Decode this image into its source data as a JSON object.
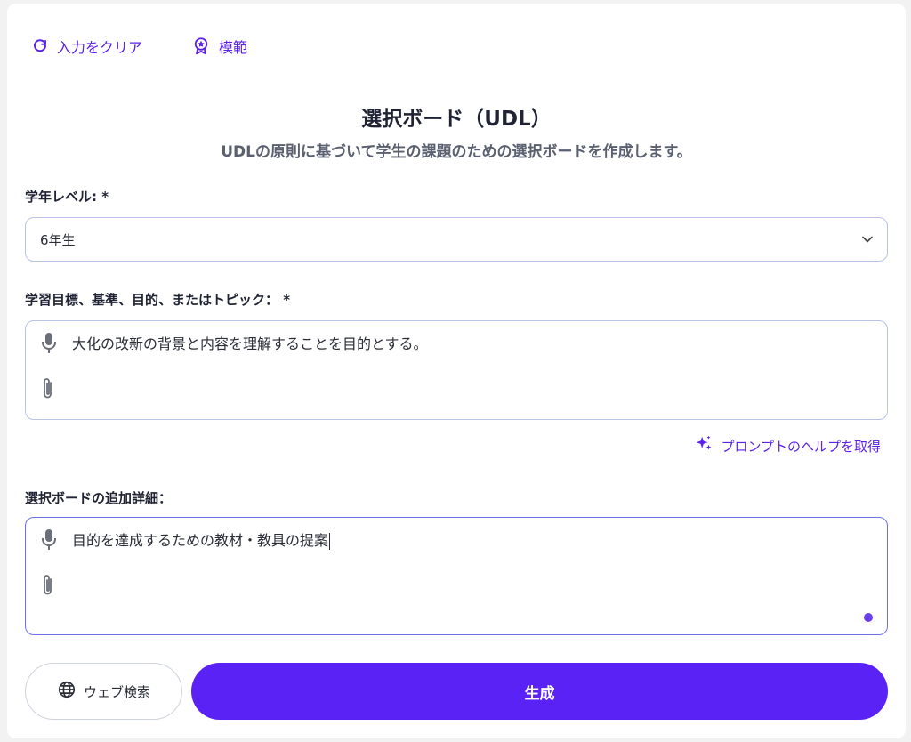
{
  "toolbar": {
    "clear_label": "入力をクリア",
    "example_label": "模範"
  },
  "header": {
    "title": "選択ボード（UDL）",
    "subtitle": "UDLの原則に基づいて学生の課題のための選択ボードを作成します。"
  },
  "form": {
    "grade": {
      "label": "学年レベル: *",
      "value": "6年生"
    },
    "objective": {
      "label": "学習目標、基準、目的、またはトピック： *",
      "value": "大化の改新の背景と内容を理解することを目的とする。"
    },
    "help_link": "プロンプトのヘルプを取得",
    "details": {
      "label": "選択ボードの追加詳細：",
      "value": "目的を達成するための教材・教具の提案"
    }
  },
  "actions": {
    "web_search_label": "ウェブ検索",
    "generate_label": "生成"
  },
  "colors": {
    "accent": "#5a22f5",
    "link": "#5b21e6",
    "border": "#b9c3e6"
  },
  "icons": [
    "refresh-icon",
    "award-icon",
    "chevron-down-icon",
    "microphone-icon",
    "paperclip-icon",
    "sparkle-icon",
    "globe-icon"
  ]
}
